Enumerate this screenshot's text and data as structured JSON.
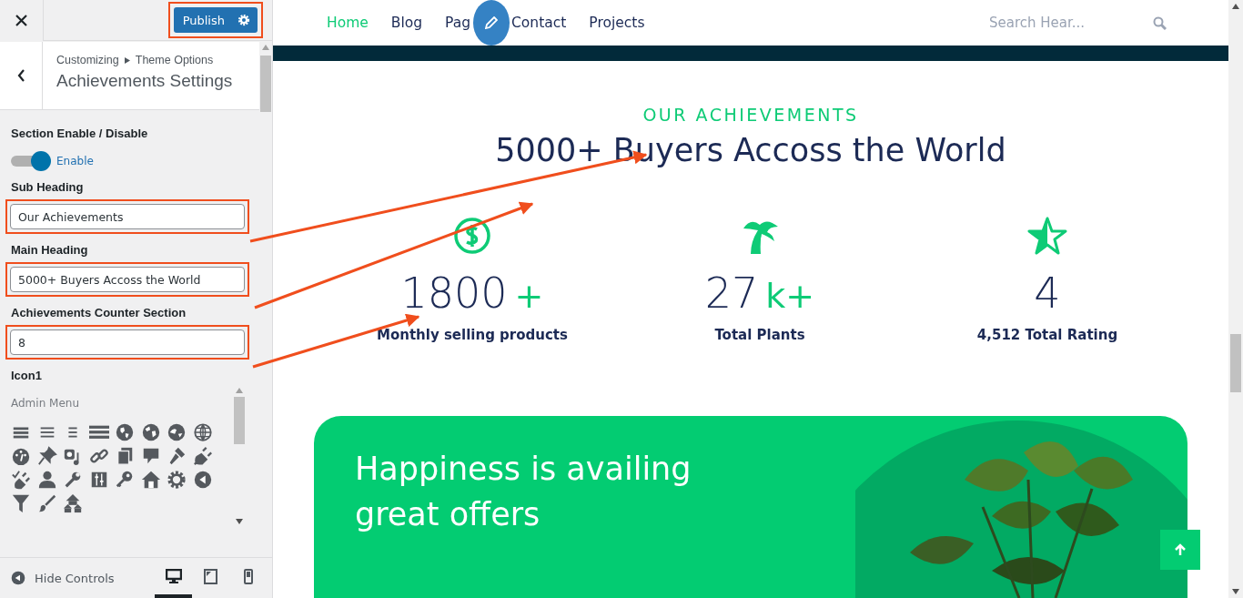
{
  "customizer": {
    "publish_button": "Publish",
    "publish_highlighted": true,
    "breadcrumb": [
      "Customizing",
      "Theme Options"
    ],
    "panel_title": "Achievements Settings",
    "controls": [
      {
        "kind": "toggle",
        "label": "Section Enable / Disable",
        "on": true,
        "toggle_label": "Enable"
      },
      {
        "kind": "text",
        "label": "Sub Heading",
        "value": "Our Achievements",
        "highlighted": true
      },
      {
        "kind": "text",
        "label": "Main Heading",
        "value": "5000+ Buyers Accoss the World",
        "highlighted": true
      },
      {
        "kind": "text",
        "label": "Achievements Counter Section",
        "value": "8",
        "highlighted": true
      },
      {
        "kind": "icon_picker",
        "label": "Icon1",
        "group": "Admin Menu"
      }
    ],
    "footer": {
      "hide_controls": "Hide Controls",
      "devices": [
        {
          "kind": "desktop",
          "selected": true
        },
        {
          "kind": "tablet",
          "selected": false
        },
        {
          "kind": "mobile",
          "selected": false
        }
      ]
    }
  },
  "preview": {
    "nav": [
      {
        "label": "Home",
        "selected": true
      },
      {
        "label": "Blog",
        "selected": false
      },
      {
        "label": "Pag",
        "selected": false
      },
      {
        "label": "Contact",
        "selected": false
      },
      {
        "label": "Projects",
        "selected": false
      }
    ],
    "search_placeholder": "Search Hear...",
    "achievements": {
      "subheading": "OUR ACHIEVEMENTS",
      "heading": "5000+ Buyers Accoss the World",
      "stats": [
        {
          "kind": "dollar",
          "number": "1800",
          "suffix": "+",
          "label": "Monthly selling products"
        },
        {
          "kind": "palm",
          "number": "27",
          "suffix": "k+",
          "label": "Total Plants"
        },
        {
          "kind": "star",
          "number": "4",
          "label": "4,512 Total Rating"
        }
      ]
    },
    "banner": {
      "title": "Happiness is availing\ngreat offers"
    }
  }
}
